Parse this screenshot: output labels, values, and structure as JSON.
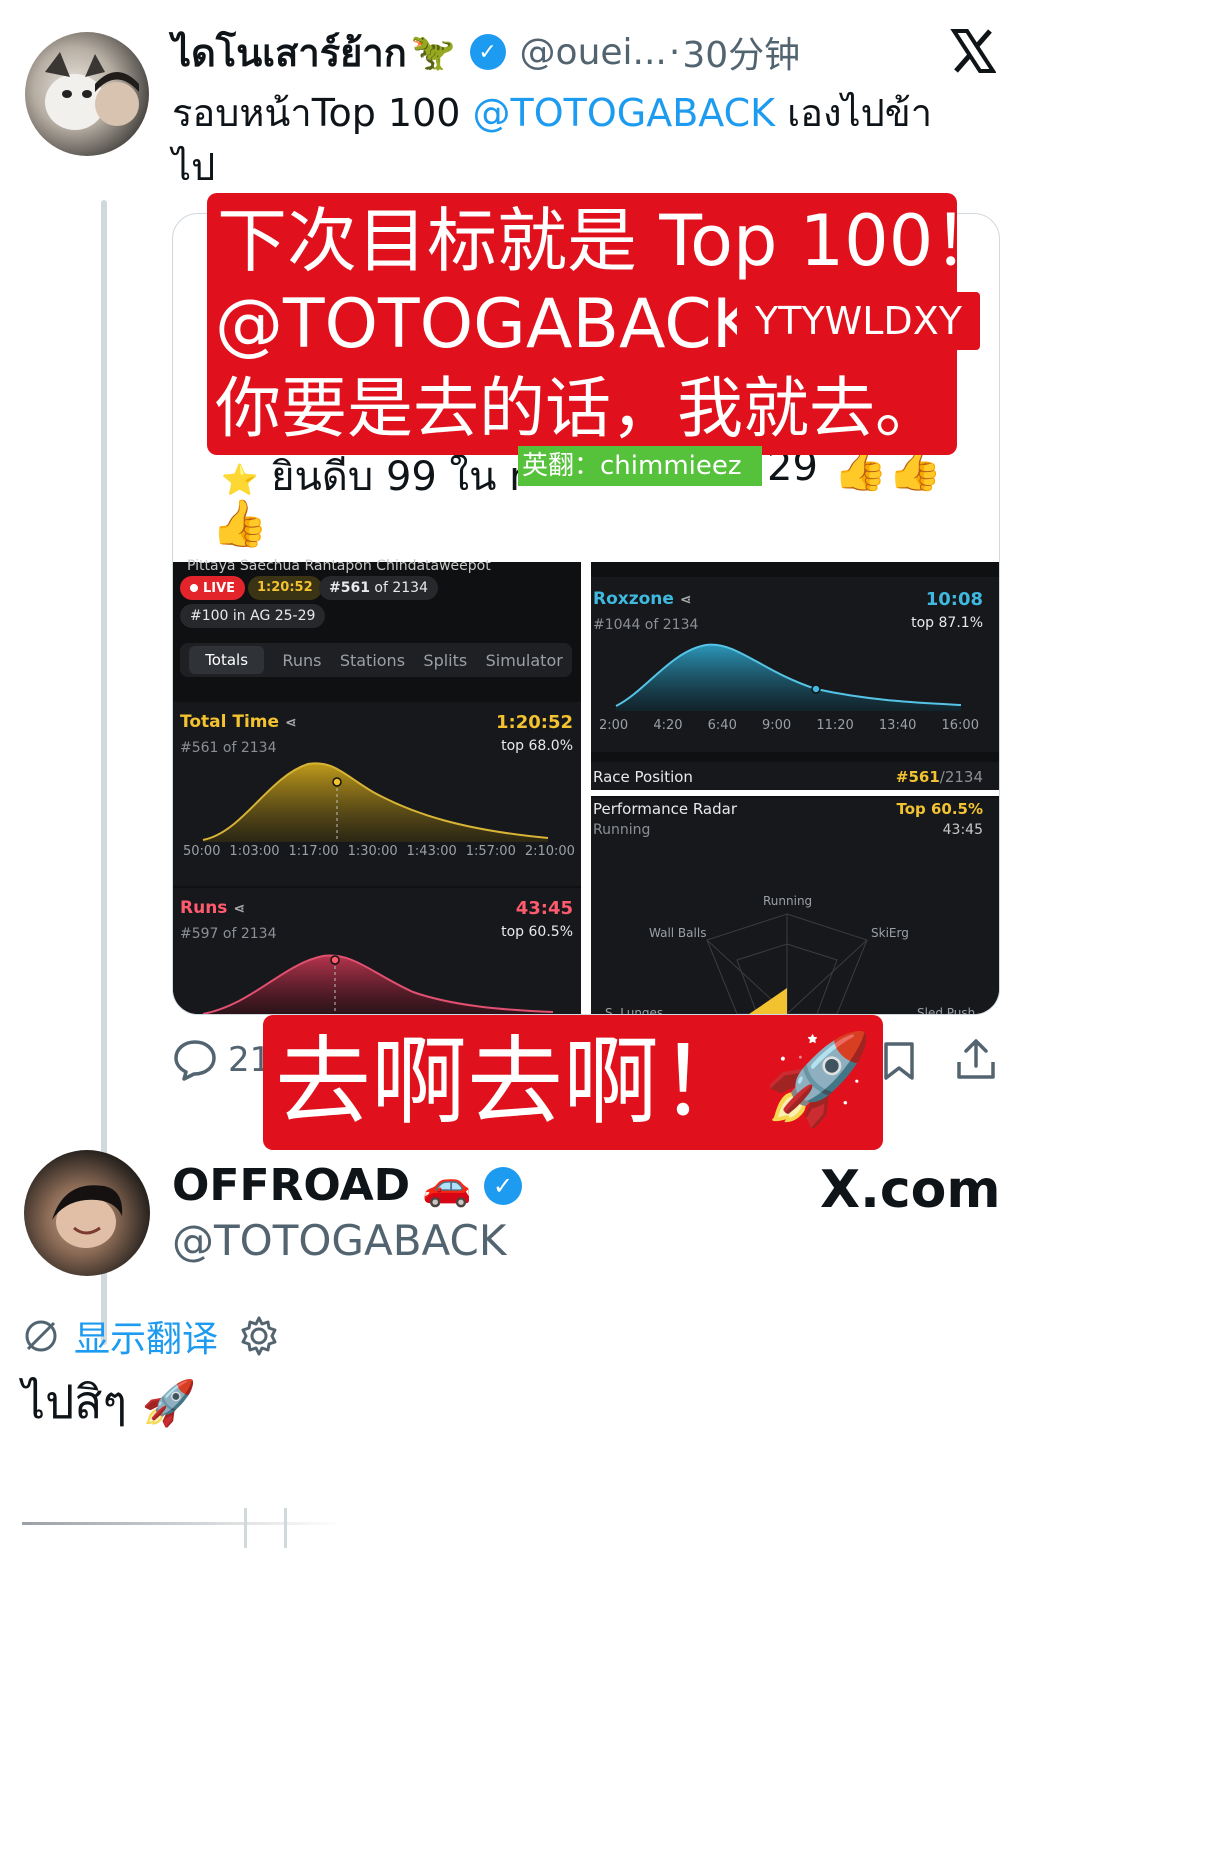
{
  "tweet1": {
    "display_name": "ไดโนเสาร์ย้าก",
    "display_emoji": "🦖",
    "handle": "@ouei...",
    "separator": "·",
    "time": "30分钟",
    "text_line1_prefix": "รอบหน้าTop 100 ",
    "mention": "@TOTOGABACK",
    "text_line1_suffix": " เองไปข้า",
    "text_line2": "ไป",
    "reply_count": "21"
  },
  "overlay_top": {
    "line1": "下次目标就是 Top 100！",
    "line2": "@TOTOGABACK",
    "tag": "YTYWLDXY",
    "line3": "你要是去的话，我就去。"
  },
  "quoted_card": {
    "partial_text": "ยินดีบ 99 ใน r",
    "partial_num": "29",
    "translator_label": "英翻：chimmieez"
  },
  "left_app": {
    "top_names": "Pittaya Saechua    Rantapon Chindataweepot",
    "live_label": "LIVE",
    "live_time": "1:20:52",
    "rank": "#561",
    "rank_of": "of 2134",
    "ag_rank": "#100 in AG 25-29",
    "tabs": [
      "Totals",
      "Runs",
      "Stations",
      "Splits",
      "Simulator"
    ],
    "total_time": {
      "title": "Total Time",
      "value": "1:20:52",
      "sub": "#561 of 2134",
      "top": "top 68.0%",
      "ticks": [
        "50:00",
        "1:03:00",
        "1:17:00",
        "1:30:00",
        "1:43:00",
        "1:57:00",
        "2:10:00"
      ]
    },
    "runs": {
      "title": "Runs",
      "value": "43:45",
      "sub": "#597 of 2134",
      "top": "top 60.5%"
    }
  },
  "right_app": {
    "roxzone": {
      "title": "Roxzone",
      "value": "10:08",
      "sub": "#1044 of 2134",
      "top": "top 87.1%",
      "ticks": [
        "2:00",
        "4:20",
        "6:40",
        "9:00",
        "11:20",
        "13:40",
        "16:00"
      ]
    },
    "race_position": {
      "title": "Race Position",
      "value": "#561",
      "of": "/2134"
    },
    "radar": {
      "title": "Performance Radar",
      "top": "Top 60.5%",
      "sub": "Running",
      "time": "43:45",
      "labels": [
        "Running",
        "Wall Balls",
        "SkiErg",
        "S. Lunges",
        "Sled Push"
      ]
    }
  },
  "overlay_bottom": {
    "text": "去啊去啊！",
    "emoji": "🚀"
  },
  "tweet2": {
    "display_name": "OFFROAD",
    "display_emoji": "🚗",
    "handle": "@TOTOGABACK",
    "watermark": "X.com",
    "translate_label": "显示翻译",
    "text": "ไปสิๆ",
    "text_emoji": "🚀"
  },
  "colors": {
    "accent_blue": "#1d9bf0",
    "overlay_red": "#e0111d",
    "gold": "#f2c230",
    "runs_red": "#ff5a6e",
    "roxzone_blue": "#3fb9e0"
  }
}
